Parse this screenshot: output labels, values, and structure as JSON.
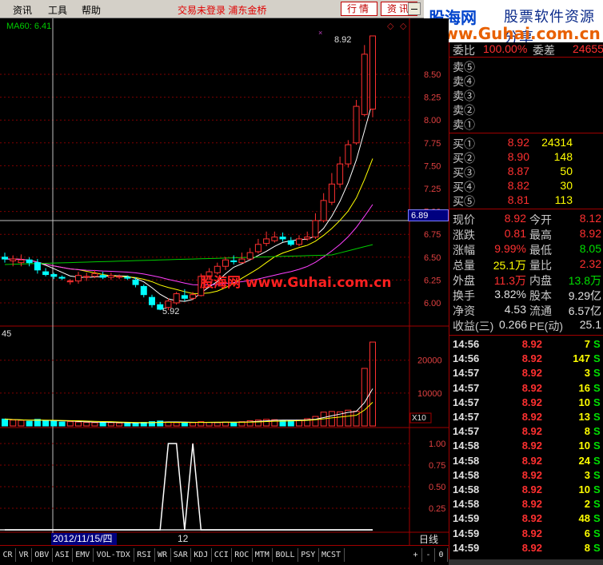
{
  "menu": {
    "items": [
      "资讯",
      "工具",
      "帮助"
    ],
    "status": "交易未登录  浦东金桥",
    "btn_quote": "行情",
    "btn_news": "资讯"
  },
  "logo": {
    "cn": "股海网",
    "tag": "股票软件资源分享",
    "url": "www.Guhai.com.cn"
  },
  "chart": {
    "ma_label": "MA60: 6.41",
    "high_label": "8.92",
    "low_label": "5.92",
    "price_ticks": [
      "8.50",
      "8.25",
      "8.00",
      "7.75",
      "7.50",
      "7.25",
      "7.00",
      "6.75",
      "6.50",
      "6.25",
      "6.00"
    ],
    "crosshair_price": "6.89",
    "watermark": "股海网 www.Guhai.com.cn",
    "volume_label": "45",
    "vol_ticks": [
      "20000",
      "10000"
    ],
    "vol_unit": "X10",
    "ind_ticks": [
      "1.00",
      "0.75",
      "0.50",
      "0.25"
    ],
    "hover_date": "2012/11/15/四",
    "x_label": "12",
    "period": "日线"
  },
  "chart_data": {
    "type": "candlestick",
    "ylim": [
      5.85,
      8.97
    ],
    "candles": [
      {
        "o": 6.5,
        "c": 6.48,
        "h": 6.55,
        "l": 6.44
      },
      {
        "o": 6.46,
        "c": 6.48,
        "h": 6.52,
        "l": 6.4
      },
      {
        "o": 6.44,
        "c": 6.47,
        "h": 6.53,
        "l": 6.4
      },
      {
        "o": 6.47,
        "c": 6.44,
        "h": 6.5,
        "l": 6.4
      },
      {
        "o": 6.44,
        "c": 6.36,
        "h": 6.48,
        "l": 6.32
      },
      {
        "o": 6.34,
        "c": 6.31,
        "h": 6.38,
        "l": 6.29
      },
      {
        "o": 6.31,
        "c": 6.29,
        "h": 6.33,
        "l": 6.26
      },
      {
        "o": 6.28,
        "c": 6.27,
        "h": 6.3,
        "l": 6.25
      },
      {
        "o": 6.23,
        "c": 6.24,
        "h": 6.26,
        "l": 6.2
      },
      {
        "o": 6.24,
        "c": 6.3,
        "h": 6.34,
        "l": 6.21
      },
      {
        "o": 6.28,
        "c": 6.29,
        "h": 6.33,
        "l": 6.24
      },
      {
        "o": 6.29,
        "c": 6.32,
        "h": 6.36,
        "l": 6.27
      },
      {
        "o": 6.3,
        "c": 6.28,
        "h": 6.34,
        "l": 6.26
      },
      {
        "o": 6.28,
        "c": 6.3,
        "h": 6.33,
        "l": 6.25
      },
      {
        "o": 6.29,
        "c": 6.29,
        "h": 6.31,
        "l": 6.26
      },
      {
        "o": 6.28,
        "c": 6.27,
        "h": 6.3,
        "l": 6.25
      },
      {
        "o": 6.25,
        "c": 6.2,
        "h": 6.28,
        "l": 6.17
      },
      {
        "o": 6.18,
        "c": 6.09,
        "h": 6.2,
        "l": 6.06
      },
      {
        "o": 6.06,
        "c": 5.98,
        "h": 6.09,
        "l": 5.95
      },
      {
        "o": 5.98,
        "c": 5.93,
        "h": 6.01,
        "l": 5.92
      },
      {
        "o": 5.95,
        "c": 6.02,
        "h": 6.05,
        "l": 5.92
      },
      {
        "o": 6.0,
        "c": 6.1,
        "h": 6.12,
        "l": 5.98
      },
      {
        "o": 6.08,
        "c": 6.05,
        "h": 6.15,
        "l": 6.02
      },
      {
        "o": 6.05,
        "c": 6.09,
        "h": 6.12,
        "l": 6.03
      },
      {
        "o": 6.08,
        "c": 6.29,
        "h": 6.32,
        "l": 6.07
      },
      {
        "o": 6.29,
        "c": 6.34,
        "h": 6.38,
        "l": 6.25
      },
      {
        "o": 6.33,
        "c": 6.4,
        "h": 6.44,
        "l": 6.31
      },
      {
        "o": 6.4,
        "c": 6.47,
        "h": 6.5,
        "l": 6.36
      },
      {
        "o": 6.46,
        "c": 6.45,
        "h": 6.52,
        "l": 6.42
      },
      {
        "o": 6.44,
        "c": 6.48,
        "h": 6.55,
        "l": 6.43
      },
      {
        "o": 6.48,
        "c": 6.55,
        "h": 6.6,
        "l": 6.47
      },
      {
        "o": 6.56,
        "c": 6.64,
        "h": 6.7,
        "l": 6.54
      },
      {
        "o": 6.65,
        "c": 6.7,
        "h": 6.78,
        "l": 6.62
      },
      {
        "o": 6.68,
        "c": 6.72,
        "h": 6.78,
        "l": 6.66
      },
      {
        "o": 6.72,
        "c": 6.7,
        "h": 6.77,
        "l": 6.67
      },
      {
        "o": 6.68,
        "c": 6.64,
        "h": 6.72,
        "l": 6.62
      },
      {
        "o": 6.64,
        "c": 6.7,
        "h": 6.74,
        "l": 6.62
      },
      {
        "o": 6.7,
        "c": 6.72,
        "h": 6.78,
        "l": 6.68
      },
      {
        "o": 6.72,
        "c": 6.9,
        "h": 6.98,
        "l": 6.7
      },
      {
        "o": 6.9,
        "c": 7.12,
        "h": 7.2,
        "l": 6.88
      },
      {
        "o": 7.1,
        "c": 7.3,
        "h": 7.42,
        "l": 7.07
      },
      {
        "o": 7.3,
        "c": 7.52,
        "h": 7.6,
        "l": 7.26
      },
      {
        "o": 7.52,
        "c": 7.73,
        "h": 7.78,
        "l": 7.48
      },
      {
        "o": 7.75,
        "c": 8.15,
        "h": 8.22,
        "l": 7.73
      },
      {
        "o": 8.06,
        "c": 8.72,
        "h": 8.82,
        "l": 8.04
      },
      {
        "o": 8.12,
        "c": 8.92,
        "h": 8.92,
        "l": 8.03
      }
    ],
    "volume": [
      2100,
      1800,
      1700,
      1400,
      2000,
      1600,
      1500,
      1200,
      1300,
      1200,
      1100,
      1000,
      1100,
      1000,
      900,
      800,
      900,
      1100,
      1300,
      1500,
      1200,
      1000,
      900,
      1000,
      1300,
      1100,
      1000,
      1200,
      1100,
      1300,
      1600,
      1800,
      2000,
      1900,
      1700,
      1600,
      1800,
      2200,
      2900,
      4200,
      4400,
      4300,
      4800,
      4500,
      17500,
      25500
    ],
    "indicator": [
      0,
      0,
      0,
      0,
      0,
      0,
      0,
      0,
      0,
      0,
      0,
      0,
      0,
      0,
      0,
      0,
      0,
      0,
      0,
      0,
      1,
      1,
      0,
      1,
      0,
      0,
      0,
      0,
      0,
      0,
      0,
      0,
      0,
      0,
      0,
      0,
      0,
      0,
      0,
      0,
      0,
      0,
      0,
      0,
      0,
      0
    ]
  },
  "quote": {
    "weibi": {
      "label": "委比",
      "v1": "100.00%",
      "label2": "委差",
      "v2": "24655"
    },
    "sells": [
      {
        "label": "卖⑤"
      },
      {
        "label": "卖④"
      },
      {
        "label": "卖③"
      },
      {
        "label": "卖②"
      },
      {
        "label": "卖①"
      }
    ],
    "buys": [
      {
        "label": "买①",
        "price": "8.92",
        "vol": "24314"
      },
      {
        "label": "买②",
        "price": "8.90",
        "vol": "148"
      },
      {
        "label": "买③",
        "price": "8.87",
        "vol": "50"
      },
      {
        "label": "买④",
        "price": "8.82",
        "vol": "30"
      },
      {
        "label": "买⑤",
        "price": "8.81",
        "vol": "113"
      }
    ],
    "stats": [
      {
        "l1": "现价",
        "v1": "8.92",
        "l2": "今开",
        "v2": "8.12"
      },
      {
        "l1": "涨跌",
        "v1": "0.81",
        "l2": "最高",
        "v2": "8.92"
      },
      {
        "l1": "涨幅",
        "v1": "9.99%",
        "l2": "最低",
        "v2": "8.05"
      },
      {
        "l1": "总量",
        "v1": "25.1万",
        "l2": "量比",
        "v2": "2.32"
      },
      {
        "l1": "外盘",
        "v1": "11.3万",
        "l2": "内盘",
        "v2": "13.8万"
      },
      {
        "l1": "换手",
        "v1": "3.82%",
        "l2": "股本",
        "v2": "9.29亿"
      },
      {
        "l1": "净资",
        "v1": "4.53",
        "l2": "流通",
        "v2": "6.57亿"
      },
      {
        "l1": "收益(三)",
        "v1": "0.266",
        "l2": "PE(动)",
        "v2": "25.1"
      }
    ],
    "ticks": [
      {
        "t": "14:56",
        "p": "8.92",
        "v": "7",
        "s": "S"
      },
      {
        "t": "14:56",
        "p": "8.92",
        "v": "147",
        "s": "S"
      },
      {
        "t": "14:57",
        "p": "8.92",
        "v": "3",
        "s": "S"
      },
      {
        "t": "14:57",
        "p": "8.92",
        "v": "16",
        "s": "S"
      },
      {
        "t": "14:57",
        "p": "8.92",
        "v": "10",
        "s": "S"
      },
      {
        "t": "14:57",
        "p": "8.92",
        "v": "13",
        "s": "S"
      },
      {
        "t": "14:57",
        "p": "8.92",
        "v": "8",
        "s": "S"
      },
      {
        "t": "14:58",
        "p": "8.92",
        "v": "10",
        "s": "S"
      },
      {
        "t": "14:58",
        "p": "8.92",
        "v": "24",
        "s": "S"
      },
      {
        "t": "14:58",
        "p": "8.92",
        "v": "3",
        "s": "S"
      },
      {
        "t": "14:58",
        "p": "8.92",
        "v": "10",
        "s": "S"
      },
      {
        "t": "14:58",
        "p": "8.92",
        "v": "2",
        "s": "S"
      },
      {
        "t": "14:59",
        "p": "8.92",
        "v": "48",
        "s": "S"
      },
      {
        "t": "14:59",
        "p": "8.92",
        "v": "6",
        "s": "S"
      },
      {
        "t": "14:59",
        "p": "8.92",
        "v": "8",
        "s": "S"
      }
    ]
  },
  "bottom_tabs": [
    "CR",
    "VR",
    "OBV",
    "ASI",
    "EMV",
    "VOL-TDX",
    "RSI",
    "WR",
    "SAR",
    "KDJ",
    "CCI",
    "ROC",
    "MTM",
    "BOLL",
    "PSY",
    "MCST"
  ],
  "bottom_controls": [
    "+",
    "-",
    "0"
  ]
}
